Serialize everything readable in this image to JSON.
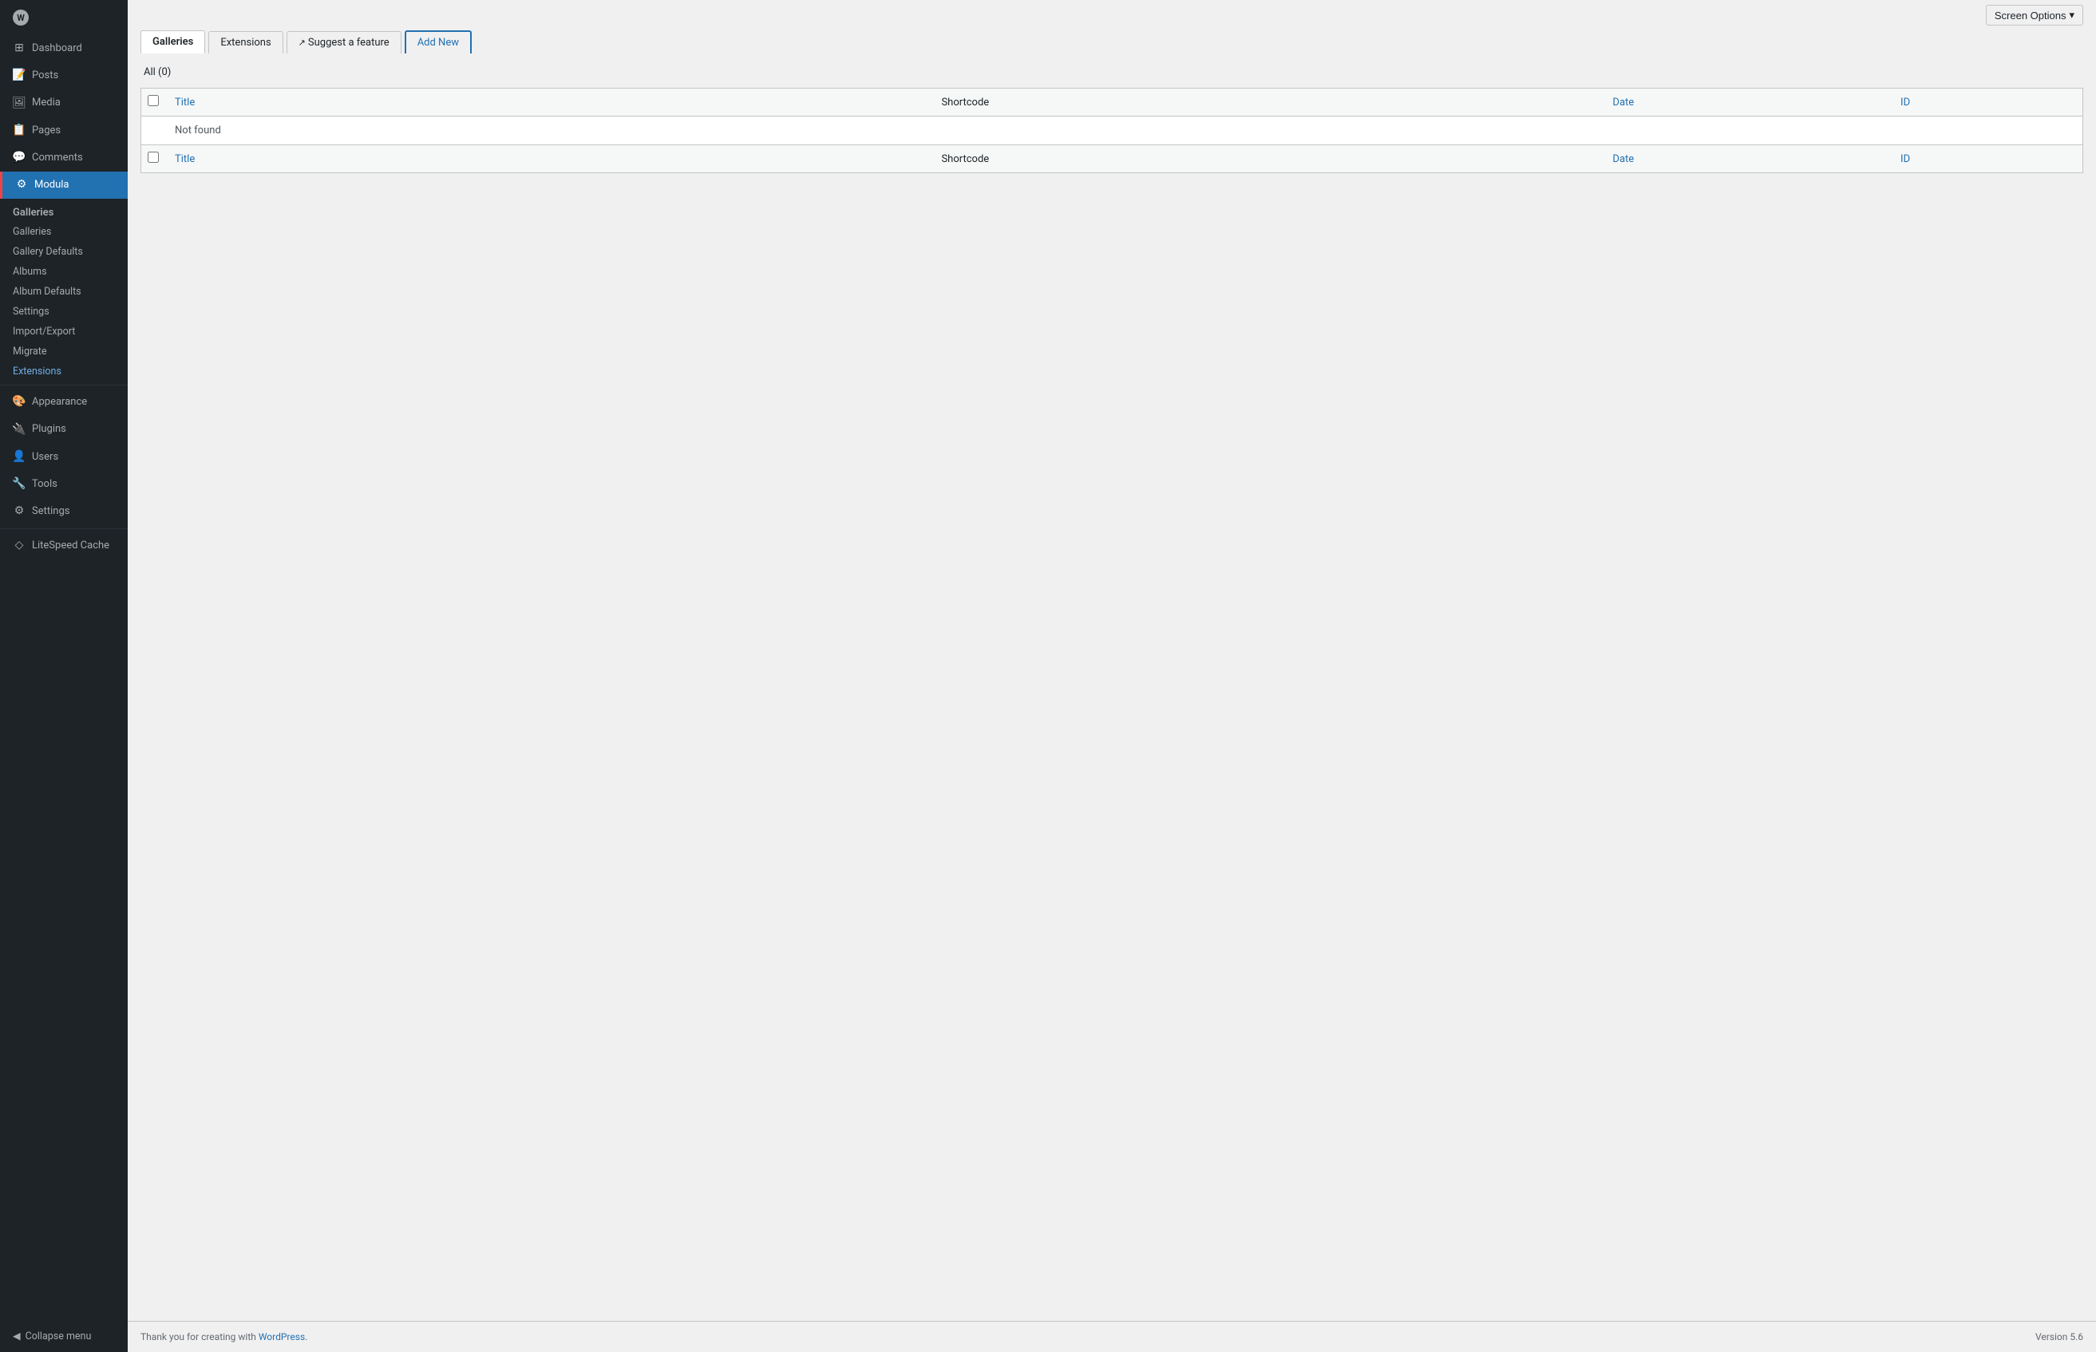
{
  "sidebar": {
    "items": [
      {
        "id": "dashboard",
        "label": "Dashboard",
        "icon": "⊞"
      },
      {
        "id": "posts",
        "label": "Posts",
        "icon": "📄"
      },
      {
        "id": "media",
        "label": "Media",
        "icon": "🖼"
      },
      {
        "id": "pages",
        "label": "Pages",
        "icon": "📋"
      },
      {
        "id": "comments",
        "label": "Comments",
        "icon": "💬"
      },
      {
        "id": "modula",
        "label": "Modula",
        "icon": "⚙",
        "active": true
      }
    ],
    "modula_section": {
      "label": "Galleries",
      "sub_items": [
        {
          "id": "galleries",
          "label": "Galleries"
        },
        {
          "id": "gallery-defaults",
          "label": "Gallery Defaults"
        },
        {
          "id": "albums",
          "label": "Albums"
        },
        {
          "id": "album-defaults",
          "label": "Album Defaults"
        },
        {
          "id": "settings",
          "label": "Settings"
        },
        {
          "id": "import-export",
          "label": "Import/Export"
        },
        {
          "id": "migrate",
          "label": "Migrate"
        },
        {
          "id": "extensions",
          "label": "Extensions",
          "active": true
        }
      ]
    },
    "lower_items": [
      {
        "id": "appearance",
        "label": "Appearance",
        "icon": "🎨"
      },
      {
        "id": "plugins",
        "label": "Plugins",
        "icon": "🔌"
      },
      {
        "id": "users",
        "label": "Users",
        "icon": "👤"
      },
      {
        "id": "tools",
        "label": "Tools",
        "icon": "🔧"
      },
      {
        "id": "settings",
        "label": "Settings",
        "icon": "⚙"
      }
    ],
    "litespeed": {
      "label": "LiteSpeed Cache",
      "icon": "◇"
    },
    "collapse": "Collapse menu"
  },
  "topbar": {
    "screen_options": "Screen Options"
  },
  "tabs": [
    {
      "id": "galleries",
      "label": "Galleries",
      "active": true
    },
    {
      "id": "extensions",
      "label": "Extensions"
    },
    {
      "id": "suggest",
      "label": "Suggest a feature",
      "external": true
    },
    {
      "id": "add-new",
      "label": "Add New",
      "highlighted": true
    }
  ],
  "status": {
    "filter": "All",
    "count": "(0)"
  },
  "table": {
    "header": {
      "checkbox": "",
      "title": "Title",
      "shortcode": "Shortcode",
      "date": "Date",
      "id": "ID"
    },
    "rows": [
      {
        "not_found": true,
        "message": "Not found"
      }
    ],
    "footer": {
      "checkbox": "",
      "title": "Title",
      "shortcode": "Shortcode",
      "date": "Date",
      "id": "ID"
    }
  },
  "footer": {
    "thank_you_text": "Thank you for creating with ",
    "wordpress_link": "WordPress",
    "version": "Version 5.6"
  }
}
